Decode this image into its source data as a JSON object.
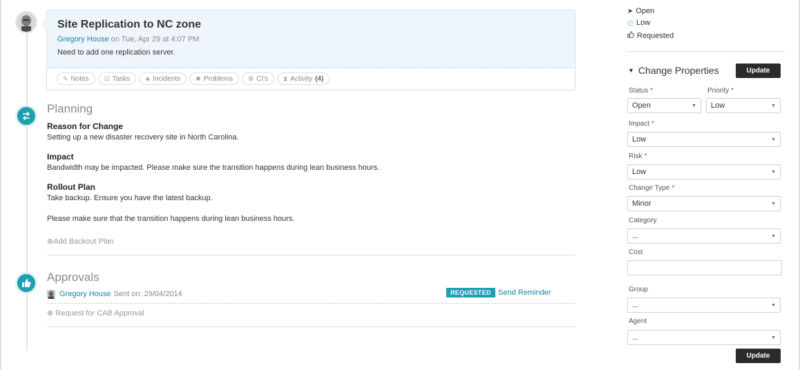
{
  "ticket": {
    "title": "Site Replication to NC zone",
    "author": "Gregory House",
    "date_text": " on Tue, Apr 29 at 4:07 PM",
    "description": "Need to add one replication server.",
    "tabs": [
      {
        "label": "Notes",
        "icon": "pencil-icon"
      },
      {
        "label": "Tasks",
        "icon": "checkbox-icon"
      },
      {
        "label": "Incidents",
        "icon": "tag-icon"
      },
      {
        "label": "Problems",
        "icon": "bug-icon"
      },
      {
        "label": "CI's",
        "icon": "gear-icon"
      },
      {
        "label": "Activity",
        "count": "(4)",
        "icon": "hourglass-icon"
      }
    ]
  },
  "planning": {
    "title": "Planning",
    "reason_heading": "Reason for Change",
    "reason_text": "Setting up a new disaster recovery site in North Carolina.",
    "impact_heading": "Impact",
    "impact_text": "Bandwidth may be impacted. Please make sure the transition happens during lean business hours.",
    "rollout_heading": "Rollout Plan",
    "rollout_text1": "Take backup. Ensure you have the latest backup.",
    "rollout_text2": "Please make sure that the transition happens during lean business hours.",
    "add_backout": "Add Backout Plan"
  },
  "approvals": {
    "title": "Approvals",
    "approver": "Gregory House",
    "sent_text": "Sent on: 29/04/2014",
    "badge": "REQUESTED",
    "reminder": "Send Reminder",
    "request_cab": "Request for CAB Approval"
  },
  "summary": {
    "status": "Open",
    "priority": "Low",
    "approval": "Requested"
  },
  "change_properties": {
    "title": "Change Properties",
    "update_label": "Update",
    "status_label": "Status",
    "status_value": "Open",
    "priority_label": "Priority",
    "priority_value": "Low",
    "impact_label": "Impact",
    "impact_value": "Low",
    "risk_label": "Risk",
    "risk_value": "Low",
    "change_type_label": "Change Type",
    "change_type_value": "Minor",
    "category_label": "Category",
    "category_value": "...",
    "cost_label": "Cost",
    "group_label": "Group",
    "group_value": "...",
    "agent_label": "Agent",
    "agent_value": "...",
    "required_mark": "*"
  },
  "colors": {
    "accent": "#1e9fb1",
    "link": "#1a7fa6",
    "button": "#2b2b2b"
  }
}
